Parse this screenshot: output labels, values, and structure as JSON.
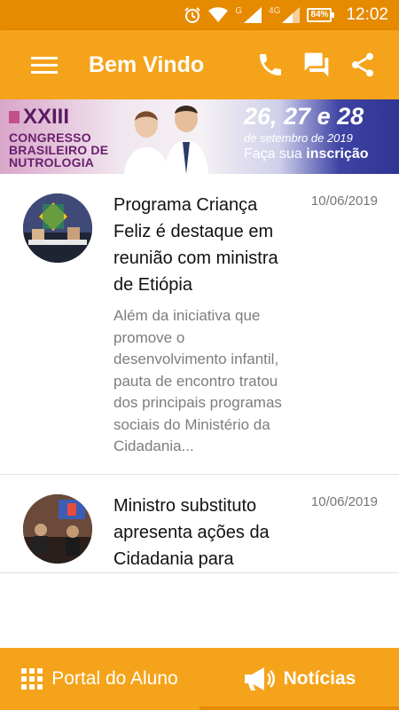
{
  "status_bar": {
    "time": "12:02",
    "battery": "84%",
    "network_label_1": "G",
    "network_label_2": "4G"
  },
  "app_bar": {
    "title": "Bem Vindo",
    "icons": [
      "menu-icon",
      "phone-icon",
      "chat-icon",
      "share-icon"
    ]
  },
  "banner": {
    "edition": "XXIII",
    "line1": "CONGRESSO",
    "line2": "BRASILEIRO DE",
    "line3": "NUTROLOGIA",
    "dates": "26, 27 e 28",
    "month": "de setembro de 2019",
    "cta_prefix": "Faça sua ",
    "cta_bold": "inscrição"
  },
  "news": [
    {
      "title": "Programa Criança Feliz é destaque em reunião com ministra de Etiópia",
      "summary": "Além da iniciativa que promove o desenvolvimento infantil, pauta de encontro tratou dos principais programas sociais do Ministério da Cidadania...",
      "date": "10/06/2019"
    },
    {
      "title": "Ministro substituto apresenta ações da Cidadania para",
      "summary": "",
      "date": "10/06/2019"
    }
  ],
  "bottom_nav": {
    "portal_label": "Portal do Aluno",
    "news_label": "Notícias"
  },
  "colors": {
    "primary": "#F5A31A",
    "primary_dark": "#E68A00"
  }
}
